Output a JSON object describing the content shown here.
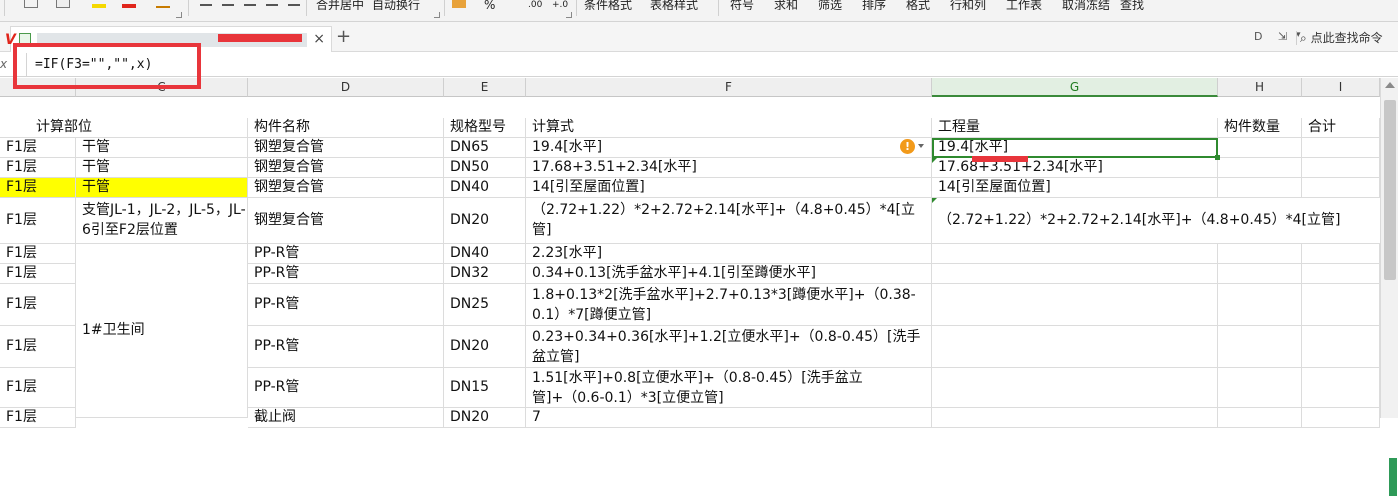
{
  "ribbon": {
    "items": [
      "合并居中",
      "自动换行",
      "条件格式",
      "表格样式",
      "符号",
      "求和",
      "筛选",
      "排序",
      "格式",
      "行和列",
      "工作表",
      "取消冻结",
      "查找"
    ],
    "percent": "%",
    "decimal_add": ".00",
    "decimal_sub": "+.0"
  },
  "tabbar": {
    "close": "×",
    "add": "+",
    "search_label": "点此查找命令"
  },
  "formula_bar": {
    "fx": "x",
    "formula": "=IF(F3=\"\",\"\",x)"
  },
  "columns": [
    "C",
    "D",
    "E",
    "F",
    "G",
    "H",
    "I"
  ],
  "header_row": {
    "part": "计算部位",
    "name": "构件名称",
    "spec": "规格型号",
    "formula": "计算式",
    "qty": "工程量",
    "count": "构件数量",
    "total": "合计"
  },
  "rows": [
    {
      "floor": "F1层",
      "part": "干管",
      "name": "钢塑复合管",
      "spec": "DN65",
      "formula": "19.4[水平]",
      "qty": "19.4[水平]"
    },
    {
      "floor": "F1层",
      "part": "干管",
      "name": "钢塑复合管",
      "spec": "DN50",
      "formula": "17.68+3.51+2.34[水平]",
      "qty": "17.68+3.51+2.34[水平]"
    },
    {
      "floor": "F1层",
      "part": "干管",
      "name": "钢塑复合管",
      "spec": "DN40",
      "formula": "14[引至屋面位置]",
      "qty": "14[引至屋面位置]"
    },
    {
      "floor": "F1层",
      "part": "支管JL-1，JL-2，JL-5，JL-6引至F2层位置",
      "name": "钢塑复合管",
      "spec": "DN20",
      "formula": "（2.72+1.22）*2+2.72+2.14[水平]+（4.8+0.45）*4[立管]",
      "qty": "（2.72+1.22）*2+2.72+2.14[水平]+（4.8+0.45）*4[立管]"
    },
    {
      "floor": "F1层",
      "name": "PP-R管",
      "spec": "DN40",
      "formula": "2.23[水平]"
    },
    {
      "floor": "F1层",
      "name": "PP-R管",
      "spec": "DN32",
      "formula": "0.34+0.13[洗手盆水平]+4.1[引至蹲便水平]"
    },
    {
      "floor": "F1层",
      "name": "PP-R管",
      "spec": "DN25",
      "formula": "1.8+0.13*2[洗手盆水平]+2.7+0.13*3[蹲便水平]+（0.38-0.1）*7[蹲便立管]"
    },
    {
      "floor": "F1层",
      "name": "PP-R管",
      "spec": "DN20",
      "formula": "0.23+0.34+0.36[水平]+1.2[立便水平]+（0.8-0.45）[洗手盆立管]"
    },
    {
      "floor": "F1层",
      "name": "PP-R管",
      "spec": "DN15",
      "formula": "1.51[水平]+0.8[立便水平]+（0.8-0.45）[洗手盆立管]+（0.6-0.1）*3[立便立管]"
    },
    {
      "floor": "F1层",
      "name": "截止阀",
      "spec": "DN20",
      "formula": "7"
    }
  ],
  "merged_part": "1#卫生间",
  "colors": {
    "accent_green": "#2f8a2f",
    "highlight_yellow": "#ffff00",
    "annotation_red": "#e8353b",
    "warning_orange": "#f29a1a"
  }
}
